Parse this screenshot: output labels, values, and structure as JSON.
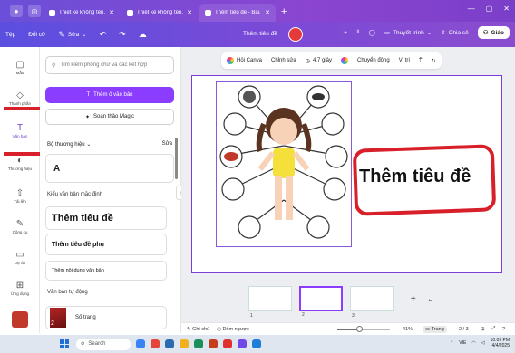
{
  "browser": {
    "tabs": [
      {
        "label": "Thiết kế không tên...",
        "active": false
      },
      {
        "label": "Thiết kế không tên...",
        "active": false
      },
      {
        "label": "Thêm tiêu đề - Bài...",
        "active": true
      }
    ],
    "new_tab": "+",
    "window_controls": [
      "—",
      "▢",
      "✕"
    ]
  },
  "toolbar": {
    "home": "Tệp",
    "resize": "Đổi cỡ",
    "edit": "Sửa",
    "undo": "↶",
    "redo": "↷",
    "save_status": "☁",
    "doc_title": "Thêm tiêu đề",
    "add": "+",
    "insights": "⫫",
    "comment": "◯",
    "present": "Thuyết trình",
    "share": "Chia sẻ",
    "edu": "Giáo"
  },
  "rail": [
    {
      "label": "Mẫu",
      "icon": "▢"
    },
    {
      "label": "Thành phần",
      "icon": "◇"
    },
    {
      "label": "Văn bản",
      "icon": "T",
      "active": true
    },
    {
      "label": "Thương hiệu",
      "icon": "◐"
    },
    {
      "label": "Tải lên",
      "icon": "⇧"
    },
    {
      "label": "Công cụ",
      "icon": "✎"
    },
    {
      "label": "Dự án",
      "icon": "▭"
    },
    {
      "label": "Ứng dụng",
      "icon": "⊞"
    },
    {
      "label": "",
      "icon": ""
    }
  ],
  "panel": {
    "search_placeholder": "Tìm kiếm phông chữ và các kết hợp",
    "add_text_button": "Thêm ô văn bản",
    "magic_write": "Soạn thảo Magic",
    "brand_label": "Bộ thương hiệu",
    "brand_edit": "Sửa",
    "brand_sample": "A",
    "default_styles_label": "Kiểu văn bản mặc định",
    "styles": [
      "Thêm tiêu đề",
      "Thêm tiêu đề phụ",
      "Thêm nội dung văn bản"
    ],
    "dynamic_label": "Văn bản tự động",
    "page_numbers": "Số trang",
    "page_thumb_number": "2"
  },
  "context_bar": {
    "items": [
      "Hỏi Canva",
      "Chỉnh sửa",
      "4.7 giây",
      "Chuyển động",
      "Vị trí"
    ]
  },
  "slide": {
    "title": "Thêm tiêu đề"
  },
  "pages": {
    "thumbs": [
      {
        "number": "1",
        "active": false
      },
      {
        "number": "2",
        "active": true
      },
      {
        "number": "3",
        "active": false
      }
    ],
    "add": "+",
    "more": "⌄"
  },
  "status": {
    "notes": "Ghi chú",
    "timer": "Đếm ngược",
    "zoom": "41%",
    "zoom_fraction": 0.41,
    "view": "Trang",
    "page_count": "2 / 3"
  },
  "taskbar": {
    "search": "Search",
    "language": "VIE",
    "time": "10:09 PM",
    "date": "4/4/2025"
  },
  "colors": {
    "accent": "#8b3dff",
    "annotation": "#d8202b"
  }
}
